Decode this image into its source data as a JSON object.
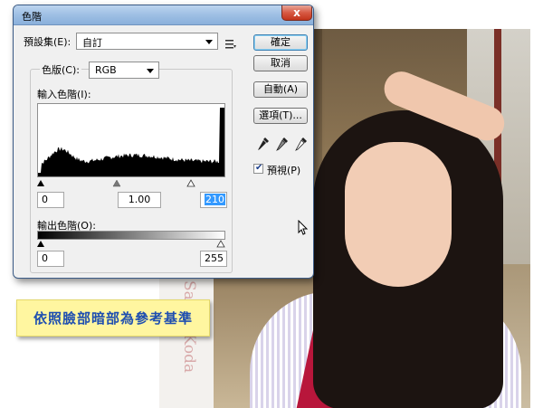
{
  "dialog": {
    "title": "色階",
    "close_glyph": "x",
    "preset_label": "預設集(E):",
    "preset_value": "自訂",
    "channel_label": "色版(C):",
    "channel_value": "RGB",
    "input_levels_label": "輸入色階(I):",
    "output_levels_label": "輸出色階(O):",
    "input_black": "0",
    "input_gamma": "1.00",
    "input_white": "210",
    "output_black": "0",
    "output_white": "255",
    "buttons": {
      "ok": "確定",
      "cancel": "取消",
      "auto": "自動(A)",
      "options": "選項(T)..."
    },
    "preview_label": "預視(P)",
    "preview_checked": true
  },
  "caption": {
    "text": "依照臉部暗部為參考基準"
  },
  "photo": {
    "watermark": "Sandy Koda"
  },
  "colors": {
    "titlebar": "#9ebfe4",
    "close": "#d75a44",
    "caption_bg": "#fff6a0",
    "caption_text": "#1f4fb0",
    "selection": "#3399ff"
  },
  "icons": [
    "close-icon",
    "menu-icon",
    "black-eyedropper-icon",
    "gray-eyedropper-icon",
    "white-eyedropper-icon",
    "arrow-cursor-icon"
  ]
}
